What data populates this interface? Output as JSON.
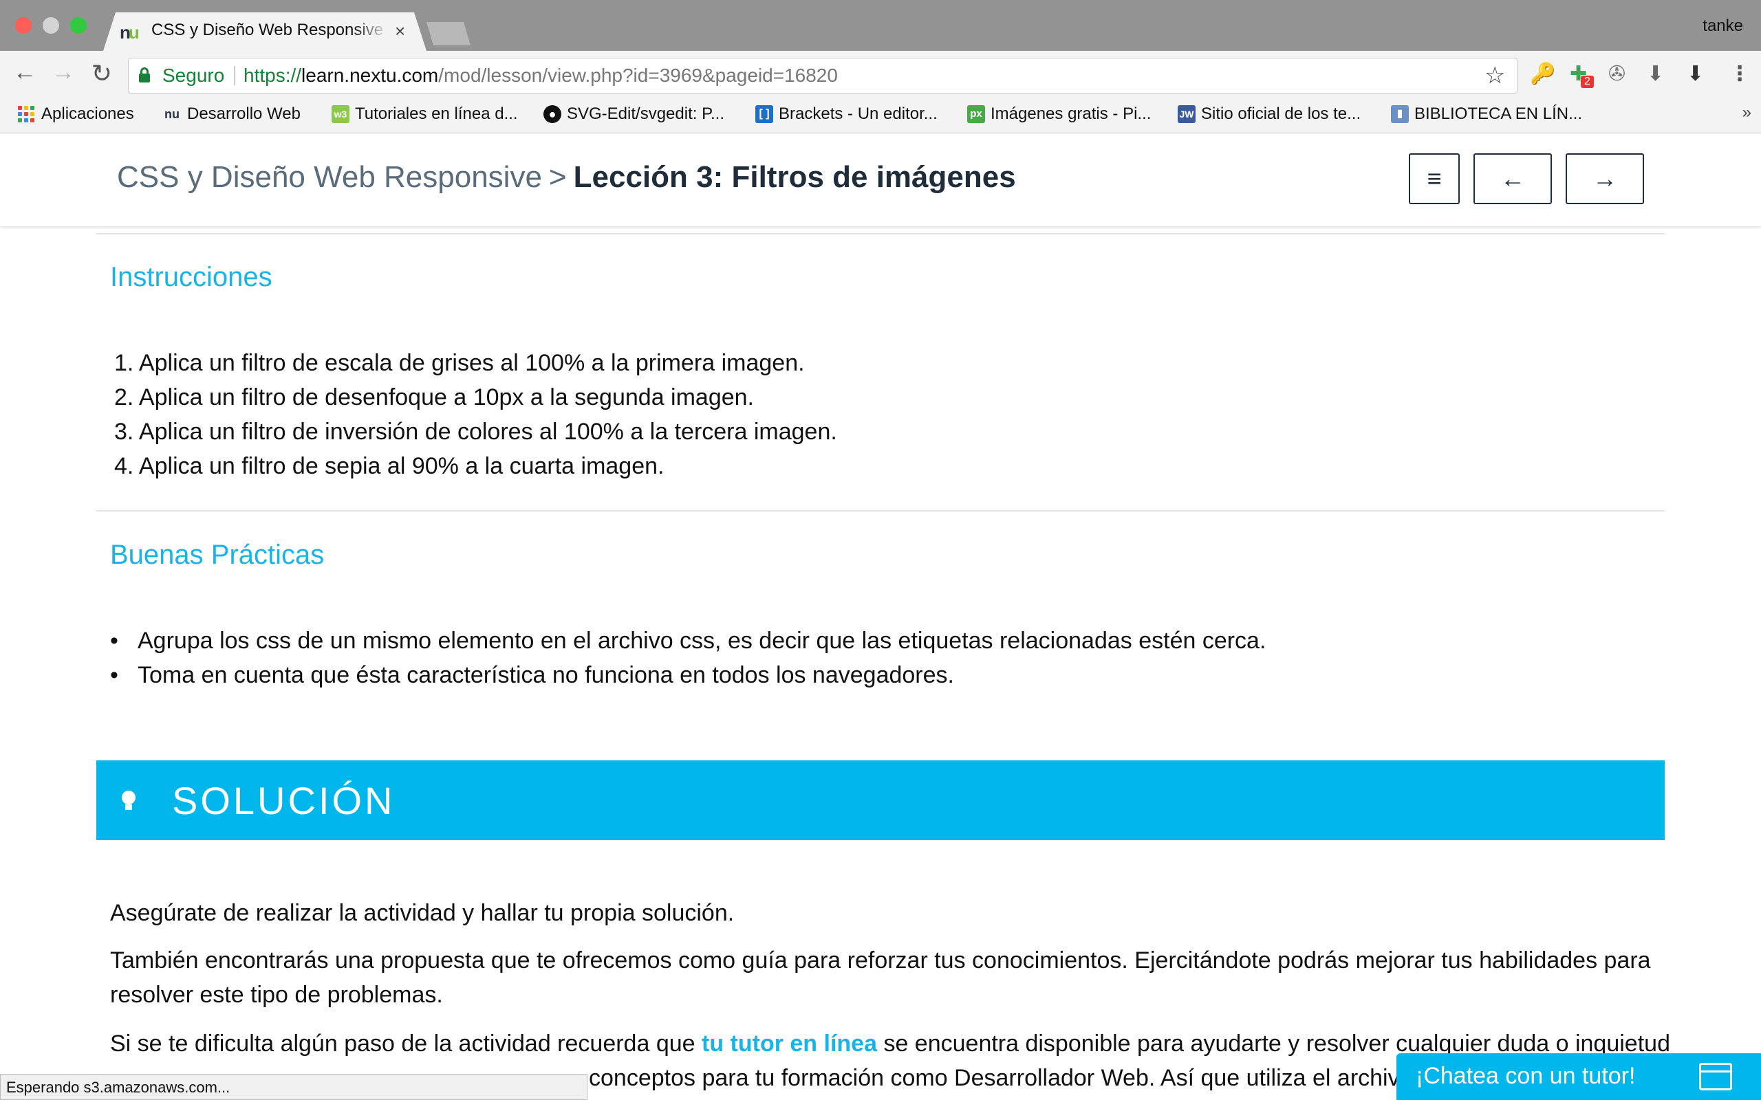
{
  "browser": {
    "tab_title": "CSS y Diseño Web Responsive",
    "tab_favicon": "nu",
    "tab_close": "×",
    "profile": "tanke",
    "secure_label": "Seguro",
    "url_scheme": "https://",
    "url_host": "learn.nextu.com",
    "url_path": "/mod/lesson/view.php?id=3969&pageid=16820",
    "extension_badge": "2",
    "bookmarks": [
      {
        "label": "Aplicaciones",
        "icon": "apps-grid-icon"
      },
      {
        "label": "Desarrollo Web",
        "icon": "nextu-icon"
      },
      {
        "label": "Tutoriales en línea d...",
        "icon": "w3-icon"
      },
      {
        "label": "SVG-Edit/svgedit: P...",
        "icon": "github-icon"
      },
      {
        "label": "Brackets - Un editor...",
        "icon": "brackets-icon"
      },
      {
        "label": "Imágenes gratis - Pi...",
        "icon": "pixabay-icon"
      },
      {
        "label": "Sitio oficial de los te...",
        "icon": "jw-icon"
      },
      {
        "label": "BIBLIOTECA EN LÍN...",
        "icon": "library-icon"
      }
    ],
    "bookmarks_overflow": "»"
  },
  "header": {
    "course": "CSS y Diseño Web Responsive",
    "separator": ">",
    "lesson": "Lección 3: Filtros de imágenes",
    "menu_glyph": "≡",
    "prev_glyph": "←",
    "next_glyph": "→"
  },
  "instructions": {
    "title": "Instrucciones",
    "items": [
      "1. Aplica un filtro de escala de grises al 100% a la primera imagen.",
      "2. Aplica un filtro de desenfoque a 10px a la segunda imagen.",
      "3. Aplica un filtro de inversión de colores al 100% a la tercera imagen.",
      "4. Aplica un filtro de sepia al 90% a la cuarta imagen."
    ]
  },
  "best_practices": {
    "title": "Buenas Prácticas",
    "items": [
      "Agrupa los css de un mismo elemento en el archivo css, es decir que las etiquetas relacionadas estén cerca.",
      "Toma en cuenta que ésta característica no funciona en todos los navegadores."
    ]
  },
  "solution": {
    "title": "SOLUCIÓN",
    "p1": "Asegúrate de realizar la actividad y hallar tu propia solución.",
    "p2": "También encontrarás una propuesta que te ofrecemos como guía para reforzar tus conocimientos. Ejercitándote podrás mejorar tus habilidades para resolver este tipo de problemas.",
    "p3_before": "Si se te dificulta algún paso de la actividad recuerda que ",
    "p3_link": "tu tutor en línea",
    "p3_after": " se encuentra disponible para ayudarte y resolver cualquier duda o inquietud",
    "p3_line2": "conceptos para tu formación como Desarrollador Web. Así que utiliza el archiv"
  },
  "status": "Esperando s3.amazonaws.com...",
  "chat": {
    "label": "¡Chatea con un tutor!"
  }
}
